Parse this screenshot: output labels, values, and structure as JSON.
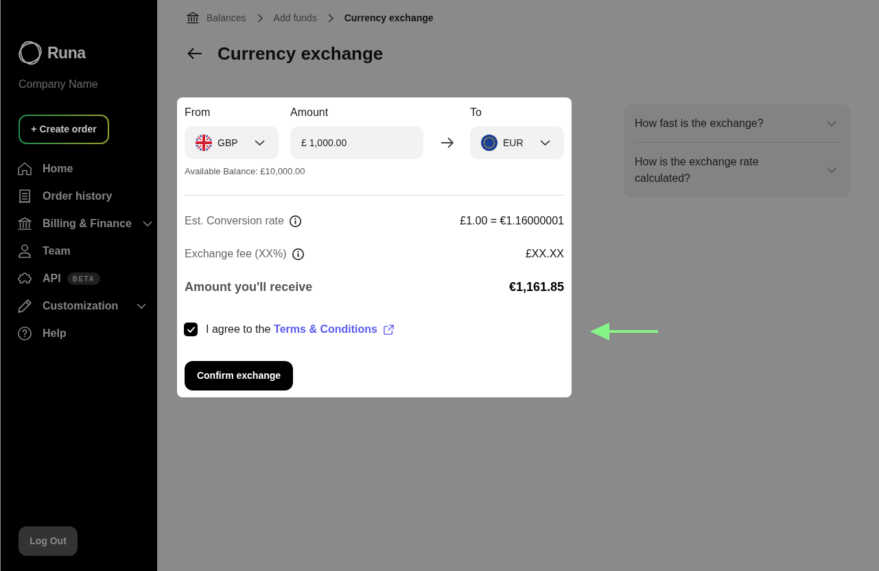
{
  "sidebar": {
    "logo": "Runa",
    "company_name": "Company Name",
    "create_button": "+ Create order",
    "nav_items": [
      {
        "label": "Home",
        "kind": "link",
        "selected": false
      },
      {
        "label": "Order history",
        "kind": "link",
        "selected": false
      },
      {
        "label": "Billing & Finance",
        "kind": "group",
        "selected": false
      },
      {
        "label": "Team",
        "kind": "link",
        "selected": false
      },
      {
        "label": "API",
        "kind": "link",
        "selected": false,
        "badge": "BETA"
      },
      {
        "label": "Customization",
        "kind": "group",
        "selected": false
      },
      {
        "label": "Help",
        "kind": "link",
        "selected": false
      }
    ],
    "logout_button": "Log Out"
  },
  "breadcrumb": [
    {
      "label": "Balances",
      "current": false
    },
    {
      "label": "Add funds",
      "current": false
    },
    {
      "label": "Currency exchange",
      "current": true
    }
  ],
  "page_title": "Currency exchange",
  "exchange_form": {
    "from": {
      "label": "From",
      "currency": "GBP"
    },
    "amount": {
      "label": "Amount",
      "value": "£ 1,000.00"
    },
    "to": {
      "label": "To",
      "currency": "EUR"
    },
    "available_balance": "Available Balance: £10,000.00",
    "summary": [
      {
        "kind": "info",
        "label": "Est. Conversion rate",
        "value": "£1.00 = €1.16000001"
      },
      {
        "kind": "info",
        "label": "Exchange fee (XX%)",
        "value": "£XX.XX"
      },
      {
        "kind": "total",
        "label": "Amount you'll receive",
        "value": "€1,161.85"
      }
    ],
    "terms": {
      "checked": true,
      "text": "I agree to the",
      "link": "Terms & Conditions"
    },
    "confirm_button": "Confirm exchange"
  },
  "faq": [
    {
      "question": "How fast is the exchange?",
      "expanded": false
    },
    {
      "question": "How is the exchange rate calculated?",
      "expanded": false
    }
  ]
}
